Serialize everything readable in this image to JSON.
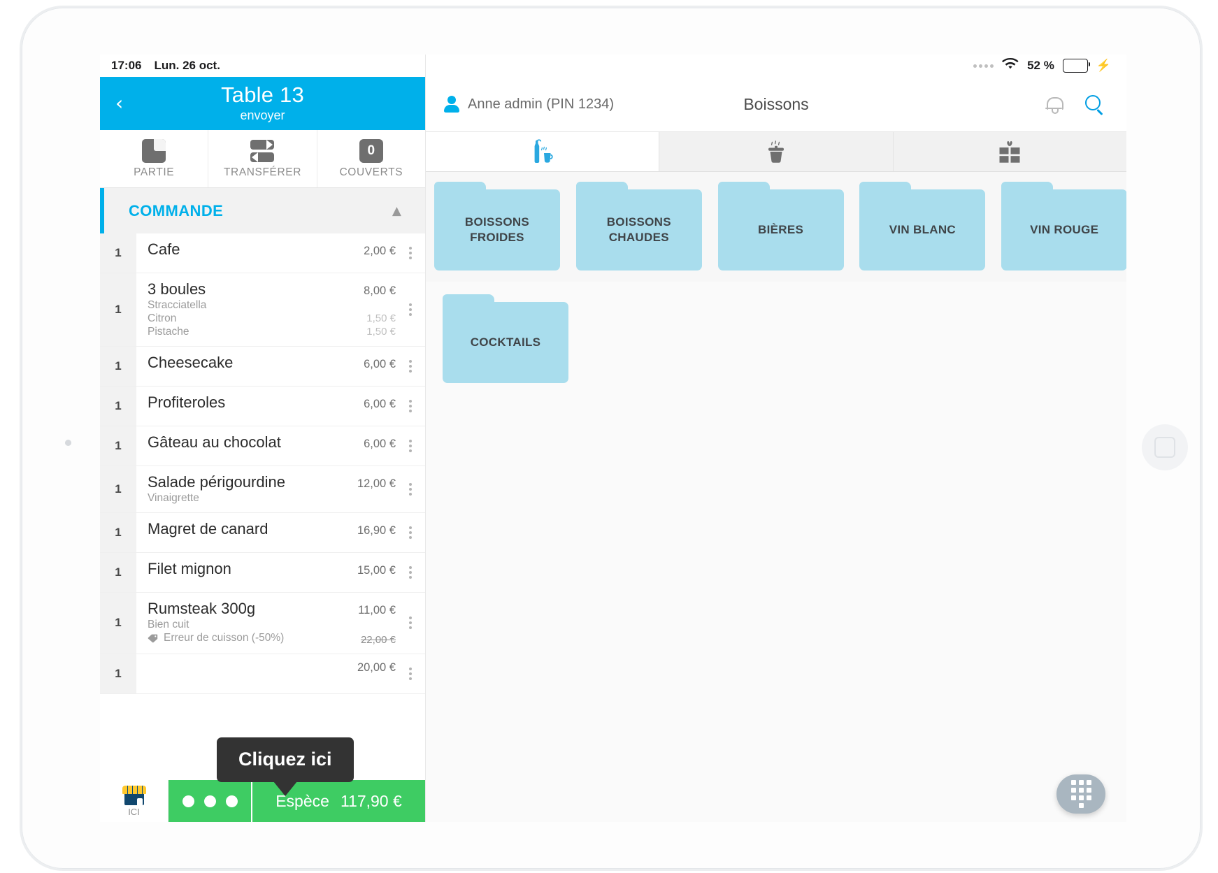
{
  "status_bar": {
    "time": "17:06",
    "date": "Lun. 26 oct.",
    "battery_percent": "52 %",
    "battery_level": 52
  },
  "table_header": {
    "back_icon": "‹",
    "title": "Table 13",
    "subtitle": "envoyer"
  },
  "actions": [
    {
      "label": "PARTIE",
      "icon": "split-icon"
    },
    {
      "label": "TRANSFÉRER",
      "icon": "transfer-icon"
    },
    {
      "label": "COUVERTS",
      "icon": "covers-icon",
      "value": "0"
    }
  ],
  "order": {
    "section_label": "COMMANDE",
    "collapse_icon": "chevron-up-icon",
    "items": [
      {
        "qty": "1",
        "name": "Cafe",
        "price": "2,00 €",
        "options": []
      },
      {
        "qty": "1",
        "name": "3 boules",
        "price": "8,00 €",
        "options": [
          {
            "name": "Stracciatella",
            "price": ""
          },
          {
            "name": "Citron",
            "price": "1,50 €"
          },
          {
            "name": "Pistache",
            "price": "1,50 €"
          }
        ]
      },
      {
        "qty": "1",
        "name": "Cheesecake",
        "price": "6,00 €",
        "options": []
      },
      {
        "qty": "1",
        "name": "Profiteroles",
        "price": "6,00 €",
        "options": []
      },
      {
        "qty": "1",
        "name": "Gâteau au chocolat",
        "price": "6,00 €",
        "options": []
      },
      {
        "qty": "1",
        "name": "Salade périgourdine",
        "price": "12,00 €",
        "options": [
          {
            "name": "Vinaigrette",
            "price": ""
          }
        ]
      },
      {
        "qty": "1",
        "name": "Magret de canard",
        "price": "16,90 €",
        "options": []
      },
      {
        "qty": "1",
        "name": "Filet mignon",
        "price": "15,00 €",
        "options": []
      },
      {
        "qty": "1",
        "name": "Rumsteak 300g",
        "price": "11,00 €",
        "options": [
          {
            "name": "Bien cuit",
            "price": ""
          },
          {
            "name": "Erreur de cuisson (-50%)",
            "price": "22,00 €",
            "discount": true
          }
        ]
      },
      {
        "qty": "1",
        "name": "",
        "price": "20,00 €",
        "options": []
      }
    ]
  },
  "tooltip": {
    "text": "Cliquez ici"
  },
  "pay_bar": {
    "ici_label": "ICI",
    "ici_icon": "shop-icon",
    "more_icon": "three-dots-icon",
    "payment_label": "Espèce",
    "payment_amount": "117,90 €"
  },
  "top_bar": {
    "user": "Anne admin (PIN 1234)",
    "user_icon": "person-icon",
    "title": "Boissons",
    "bell_icon": "bell-icon",
    "search_icon": "search-icon"
  },
  "category_tabs": [
    {
      "icon": "drinks-icon",
      "active": true
    },
    {
      "icon": "hot-dish-icon",
      "active": false
    },
    {
      "icon": "gift-icon",
      "active": false
    }
  ],
  "folders": [
    {
      "label": "BOISSONS FROIDES"
    },
    {
      "label": "BOISSONS CHAUDES"
    },
    {
      "label": "BIÈRES"
    },
    {
      "label": "VIN BLANC"
    },
    {
      "label": "VIN ROUGE"
    },
    {
      "label": "COCKTAILS"
    }
  ],
  "keypad_fab": {
    "icon": "keypad-icon"
  },
  "colors": {
    "accent_blue": "#00b0ea",
    "folder_blue": "#a9dded",
    "pay_green": "#3ecc63",
    "tooltip_dark": "#333333"
  }
}
